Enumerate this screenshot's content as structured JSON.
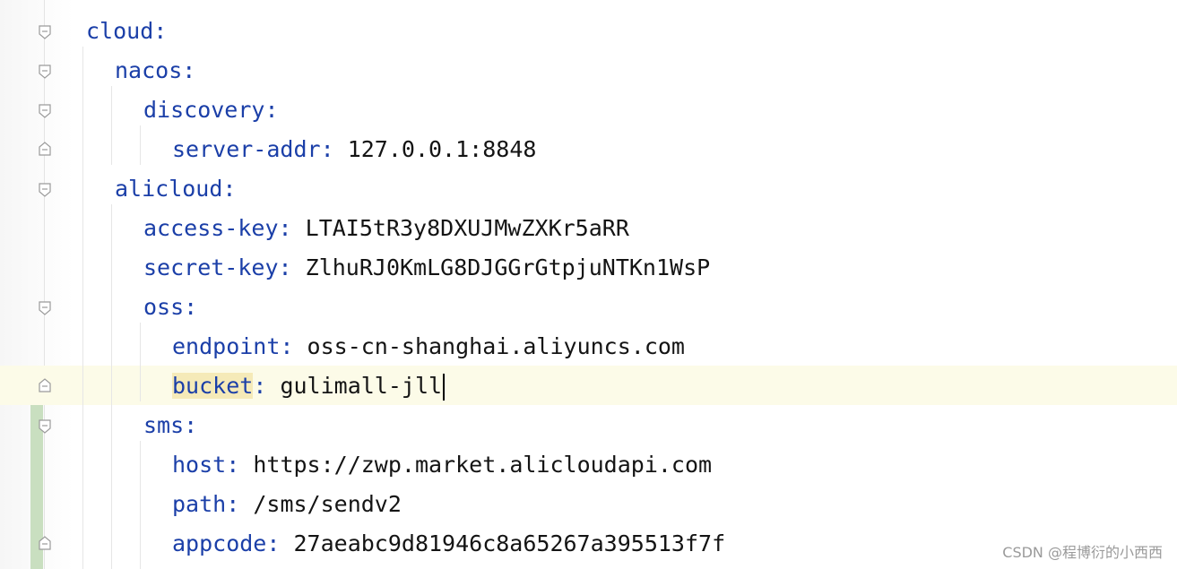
{
  "editor": {
    "lines": [
      {
        "key": "cloud",
        "value": ""
      },
      {
        "key": "nacos",
        "value": ""
      },
      {
        "key": "discovery",
        "value": ""
      },
      {
        "key": "server-addr",
        "value": "127.0.0.1:8848"
      },
      {
        "key": "alicloud",
        "value": ""
      },
      {
        "key": "access-key",
        "value": "LTAI5tR3y8DXUJMwZXKr5aRR"
      },
      {
        "key": "secret-key",
        "value": "ZlhuRJ0KmLG8DJGGrGtpjuNTKn1WsP"
      },
      {
        "key": "oss",
        "value": ""
      },
      {
        "key": "endpoint",
        "value": "oss-cn-shanghai.aliyuncs.com"
      },
      {
        "key": "bucket",
        "value": "gulimall-jll"
      },
      {
        "key": "sms",
        "value": ""
      },
      {
        "key": "host",
        "value": "https://zwp.market.alicloudapi.com"
      },
      {
        "key": "path",
        "value": "/sms/sendv2"
      },
      {
        "key": "appcode",
        "value": "27aeabc9d81946c8a65267a395513f7f"
      }
    ],
    "colon": ":"
  },
  "watermark": "CSDN @程博衍的小西西",
  "colors": {
    "key": "#1b3fa8",
    "value": "#141414",
    "caret_row": "#fcfbe8",
    "change_bar": "#c9dfc0"
  }
}
